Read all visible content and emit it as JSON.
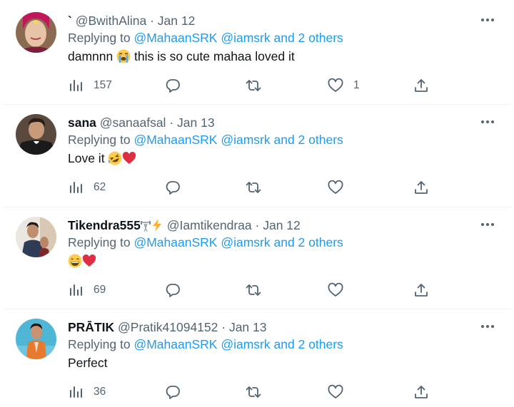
{
  "tweets": [
    {
      "display_name": "`",
      "handle": "@BwithAlina",
      "separator": "·",
      "date": "Jan 12",
      "replying_prefix": "Replying to",
      "mention1": "@MahaanSRK",
      "mention2": "@iamsrk",
      "and_others": "and 2 others",
      "text": "damnnn",
      "text_after": "this is so cute mahaa loved it",
      "views": "157",
      "likes": "1",
      "emoji_names": [
        "loudly-crying-face-emoji"
      ]
    },
    {
      "display_name": "sana",
      "handle": "@sanaafsal",
      "separator": "·",
      "date": "Jan 13",
      "replying_prefix": "Replying to",
      "mention1": "@MahaanSRK",
      "mention2": "@iamsrk",
      "and_others": "and 2 others",
      "text": "Love it",
      "views": "62",
      "likes": "",
      "emoji_names": [
        "rolling-on-floor-laughing-emoji",
        "red-heart-emoji"
      ]
    },
    {
      "display_name": "Tikendra555",
      "handle": "@Iamtikendraa",
      "separator": "·",
      "date": "Jan 12",
      "replying_prefix": "Replying to",
      "mention1": "@MahaanSRK",
      "mention2": "@iamsrk",
      "and_others": "and 2 others",
      "text": "",
      "views": "69",
      "likes": "",
      "emoji_names": [
        "grinning-face-emoji",
        "red-heart-emoji"
      ]
    },
    {
      "display_name": "PRĀTIK",
      "handle": "@Pratik41094152",
      "separator": "·",
      "date": "Jan 13",
      "replying_prefix": "Replying to",
      "mention1": "@MahaanSRK",
      "mention2": "@iamsrk",
      "and_others": "and 2 others",
      "text": "Perfect",
      "views": "36",
      "likes": ""
    }
  ],
  "icons": {
    "views": "views-chart-icon",
    "reply": "reply-icon",
    "retweet": "retweet-icon",
    "like": "heart-icon",
    "share": "share-icon",
    "more": "more-dots-icon"
  },
  "colors": {
    "link": "#1d9bf0",
    "secondary_text": "#536471",
    "primary_text": "#0f1419",
    "divider": "#eff3f4"
  }
}
